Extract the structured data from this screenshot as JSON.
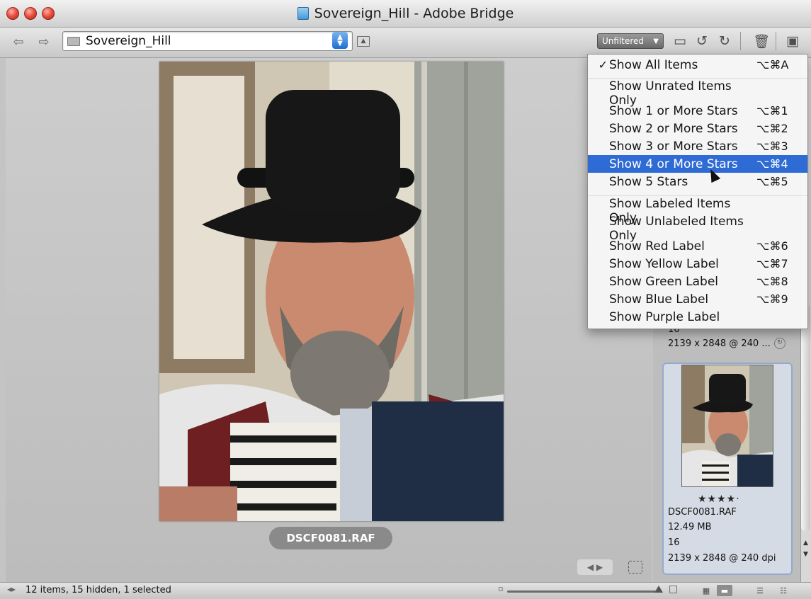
{
  "window": {
    "title": "Sovereign_Hill - Adobe Bridge"
  },
  "toolbar": {
    "path": "Sovereign_Hill",
    "filter_label": "Unfiltered"
  },
  "filter_menu": {
    "items": [
      {
        "label": "Show All Items",
        "shortcut": "⌥⌘A",
        "checked": "✓"
      },
      {
        "label": "Show Unrated Items Only",
        "shortcut": ""
      },
      {
        "label": "Show 1 or More Stars",
        "shortcut": "⌥⌘1"
      },
      {
        "label": "Show 2 or More Stars",
        "shortcut": "⌥⌘2"
      },
      {
        "label": "Show 3 or More Stars",
        "shortcut": "⌥⌘3"
      },
      {
        "label": "Show 4 or More Stars",
        "shortcut": "⌥⌘4"
      },
      {
        "label": "Show 5 Stars",
        "shortcut": "⌥⌘5"
      },
      {
        "label": "Show Labeled Items Only",
        "shortcut": ""
      },
      {
        "label": "Show Unlabeled Items Only",
        "shortcut": ""
      },
      {
        "label": "Show Red Label",
        "shortcut": "⌥⌘6"
      },
      {
        "label": "Show Yellow Label",
        "shortcut": "⌥⌘7"
      },
      {
        "label": "Show Green Label",
        "shortcut": "⌥⌘8"
      },
      {
        "label": "Show Blue Label",
        "shortcut": "⌥⌘9"
      },
      {
        "label": "Show Purple Label",
        "shortcut": ""
      }
    ],
    "highlighted": "Show 4 or More Stars"
  },
  "preview": {
    "filename": "DSCF0081.RAF"
  },
  "filmstrip": {
    "prev_card": {
      "bits": "16",
      "dimensions": "2139 x 2848 @ 240 ..."
    },
    "selected_card": {
      "stars": "★★★★·",
      "filename": "DSCF0081.RAF",
      "size": "12.49 MB",
      "bits": "16",
      "dimensions": "2139 x 2848 @ 240 dpi"
    }
  },
  "status": {
    "text": "12 items, 15 hidden, 1 selected"
  },
  "colors": {
    "menu_highlight": "#2f6bd4",
    "selection_border": "#93aacd"
  }
}
